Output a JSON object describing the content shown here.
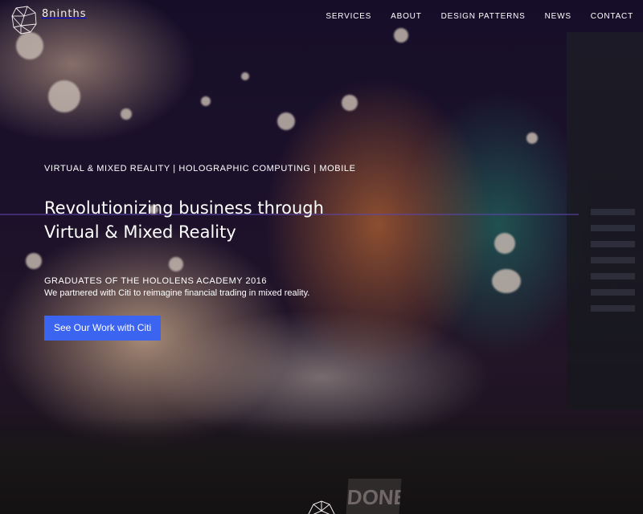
{
  "brand": {
    "name": "8ninths"
  },
  "nav": {
    "items": [
      {
        "label": "SERVICES"
      },
      {
        "label": "ABOUT"
      },
      {
        "label": "DESIGN PATTERNS"
      },
      {
        "label": "NEWS"
      },
      {
        "label": "CONTACT"
      }
    ]
  },
  "hero": {
    "eyebrow": "VIRTUAL & MIXED REALITY | HOLOGRAPHIC COMPUTING | MOBILE",
    "headline": "Revolutionizing business through Virtual & Mixed Reality",
    "sub_title": "GRADUATES OF THE HOLOLENS ACADEMY 2016",
    "sub_text": "We partnered with Citi to reimagine financial trading in mixed reality.",
    "cta_label": "See Our Work with Citi"
  },
  "background": {
    "desk_label": "DONE"
  },
  "colors": {
    "cta": "#3b64f0",
    "text": "#ffffff"
  }
}
